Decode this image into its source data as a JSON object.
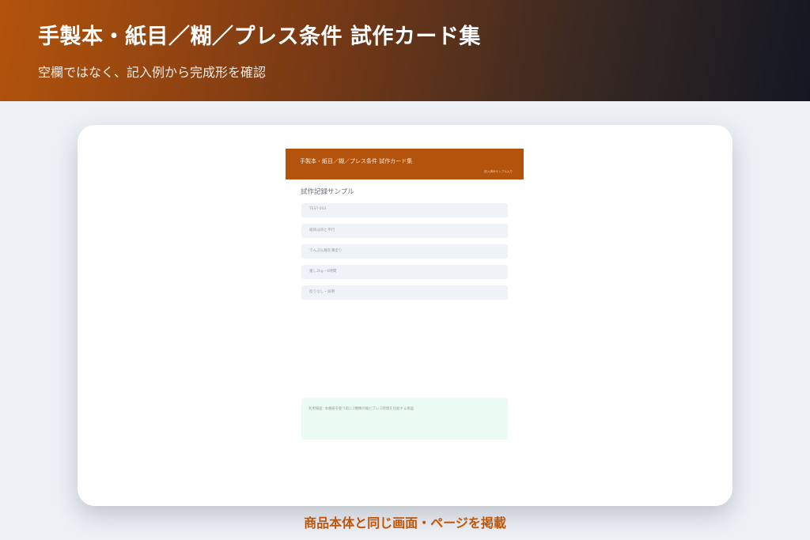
{
  "hero": {
    "title": "手製本・紙目／糊／プレス条件 試作カード集",
    "subtitle": "空欄ではなく、記入例から完成形を確認"
  },
  "document": {
    "header_title": "手製本・紙目／糊／プレス条件 試作カード集",
    "header_tag": "記入済みサンプル入り",
    "section_title": "試作記録サンプル",
    "fields": [
      {
        "value": "TEST-003"
      },
      {
        "value": "紙目は背と平行"
      },
      {
        "value": "でんぷん糊を薄塗り"
      },
      {
        "value": "重し2kg・6時間"
      },
      {
        "value": "反りなし・採用"
      }
    ],
    "note": "利用場面: 本番紙を使う前に2種類の糊とプレス時間を比較する場面"
  },
  "caption": "商品本体と同じ画面・ページを掲載",
  "colors": {
    "accent": "#b3530c",
    "hero_dark": "#121722",
    "page_bg": "#edf0f5",
    "field_bg": "#eff2f7",
    "note_bg": "#ebfbf3",
    "caption": "#c0550b"
  }
}
